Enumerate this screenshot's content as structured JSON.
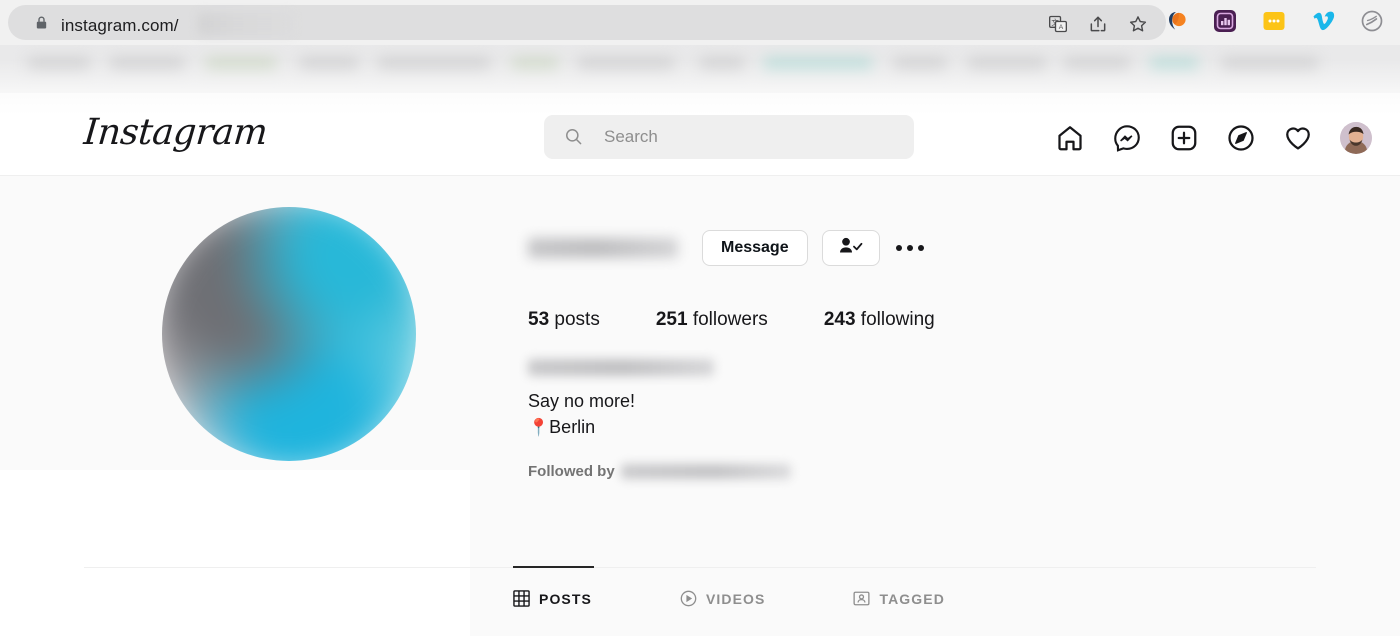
{
  "browser": {
    "url": "instagram.com/",
    "lock_icon": "lock-icon",
    "omnibox_actions": [
      "translate-icon",
      "share-icon",
      "bookmark-star-icon"
    ],
    "extensions": [
      {
        "name": "grammarly-extension-icon",
        "color": "#f28b30"
      },
      {
        "name": "analytics-extension-icon",
        "color": "#5b2a63"
      },
      {
        "name": "notes-extension-icon",
        "color": "#fcc417"
      },
      {
        "name": "vimeo-extension-icon",
        "color": "#1ab7ea"
      },
      {
        "name": "adblock-extension-icon",
        "color": "#8e8e93"
      }
    ]
  },
  "header": {
    "logo": "Instagram",
    "search": {
      "placeholder": "Search",
      "value": "",
      "icon": "search-icon"
    },
    "nav": [
      {
        "name": "home-icon",
        "label": "Home"
      },
      {
        "name": "messenger-icon",
        "label": "Messages"
      },
      {
        "name": "create-post-icon",
        "label": "New post"
      },
      {
        "name": "explore-compass-icon",
        "label": "Explore"
      },
      {
        "name": "activity-heart-icon",
        "label": "Notifications"
      },
      {
        "name": "profile-avatar",
        "label": "Profile"
      }
    ]
  },
  "profile": {
    "avatar": "profile-picture",
    "username": "",
    "actions": {
      "message_label": "Message",
      "following_icon": "person-check-icon",
      "more_icon": "more-options-icon"
    },
    "stats": [
      {
        "value": "53",
        "label": "posts"
      },
      {
        "value": "251",
        "label": "followers"
      },
      {
        "value": "243",
        "label": "following"
      }
    ],
    "bio": {
      "display_name": "",
      "line1": "Say no more!",
      "location_pin": "📍",
      "location": "Berlin"
    },
    "followed_by_label": "Followed by",
    "followed_by_names": ""
  },
  "tabs": [
    {
      "label": "POSTS",
      "icon": "grid-icon",
      "active": true
    },
    {
      "label": "VIDEOS",
      "icon": "play-circle-icon",
      "active": false
    },
    {
      "label": "TAGGED",
      "icon": "tagged-person-icon",
      "active": false
    }
  ],
  "colors": {
    "page_bg": "#fafafa",
    "chrome_bg": "#f1f1f1",
    "omnibox_bg": "#dededf",
    "search_bg": "#efefef",
    "text_primary": "#17171a",
    "text_secondary": "#8e8e8e",
    "border": "#dbdbdb",
    "accent_dark": "#262626"
  }
}
